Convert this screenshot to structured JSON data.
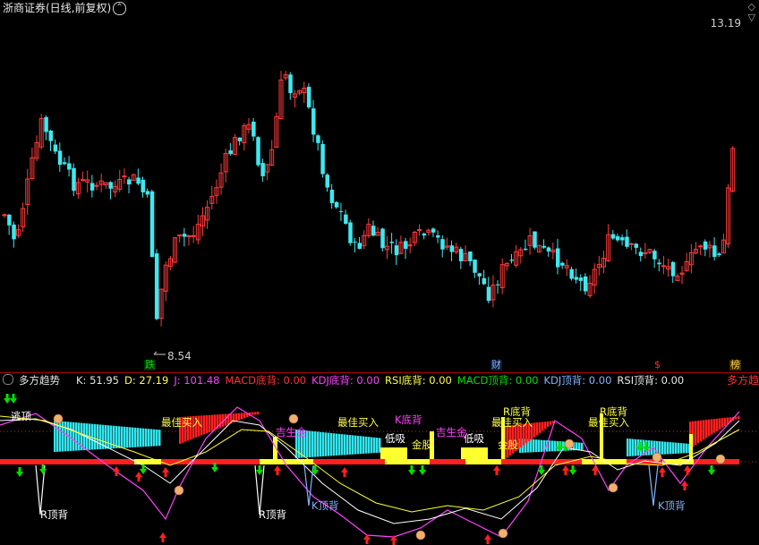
{
  "window": {
    "title": "浙商证券(日线,前复权)",
    "title_button_glyph": "⌃",
    "corner_icons": [
      "◇",
      "▽"
    ]
  },
  "price_panel": {
    "top_price_label": "13.19",
    "low_price_label": "8.54",
    "marker_tags": [
      {
        "text": "跌",
        "color": "#00dd00",
        "bg": "#0a2a0a"
      },
      {
        "text": "财",
        "color": "#7fb3ff",
        "bg": "#0a1a30"
      },
      {
        "text": "$",
        "color": "#ff3030",
        "bg": "#000000"
      },
      {
        "text": "榜",
        "color": "#ffd24a",
        "bg": "#3a2a00"
      }
    ]
  },
  "indicator_panel": {
    "name": "多方趋势",
    "right_label": "多方趋",
    "readouts": [
      {
        "label": "K: 51.95",
        "color": "#e6e6e6"
      },
      {
        "label": "D: 27.19",
        "color": "#ffff40"
      },
      {
        "label": "J: 101.48",
        "color": "#ff40ff"
      },
      {
        "label": "MACD底背: 0.00",
        "color": "#ff3030"
      },
      {
        "label": "KDJ底背: 0.00",
        "color": "#ff40ff"
      },
      {
        "label": "RSI底背: 0.00",
        "color": "#ffff40"
      },
      {
        "label": "MACD顶背: 0.00",
        "color": "#00dd00"
      },
      {
        "label": "KDJ顶背: 0.00",
        "color": "#7fb3ff"
      },
      {
        "label": "RSI顶背: 0.00",
        "color": "#e6e6e6"
      }
    ],
    "annotations": [
      {
        "text": "逃顶",
        "color": "#ffffff"
      },
      {
        "text": "最佳买入",
        "color": "#ffff40"
      },
      {
        "text": "最佳买入",
        "color": "#ffff40"
      },
      {
        "text": "最佳买入",
        "color": "#ffff40"
      },
      {
        "text": "最佳买入",
        "color": "#ffff40"
      },
      {
        "text": "K底背",
        "color": "#ff40ff"
      },
      {
        "text": "R底背",
        "color": "#ffff40"
      },
      {
        "text": "R底背",
        "color": "#ffff40"
      },
      {
        "text": "低吸",
        "color": "#ffffff"
      },
      {
        "text": "低吸",
        "color": "#ffffff"
      },
      {
        "text": "金股",
        "color": "#ffff40"
      },
      {
        "text": "金股",
        "color": "#ffff40"
      },
      {
        "text": "吉生金",
        "color": "#ff40ff"
      },
      {
        "text": "吉生金",
        "color": "#ff40ff"
      },
      {
        "text": "R顶背",
        "color": "#ffffff"
      },
      {
        "text": "R顶背",
        "color": "#ffffff"
      },
      {
        "text": "K顶背",
        "color": "#7fb3ff"
      },
      {
        "text": "K顶背",
        "color": "#7fb3ff"
      }
    ]
  },
  "colors": {
    "up": "#ff3a3a",
    "down": "#3fe8f0",
    "cyan_fill": "#33e6ee",
    "red_fill": "#ff2020",
    "yellow": "#ffff30",
    "magenta": "#ff40ff",
    "white": "#ffffff",
    "green_arrow": "#00e000",
    "red_arrow": "#ff2020"
  }
}
